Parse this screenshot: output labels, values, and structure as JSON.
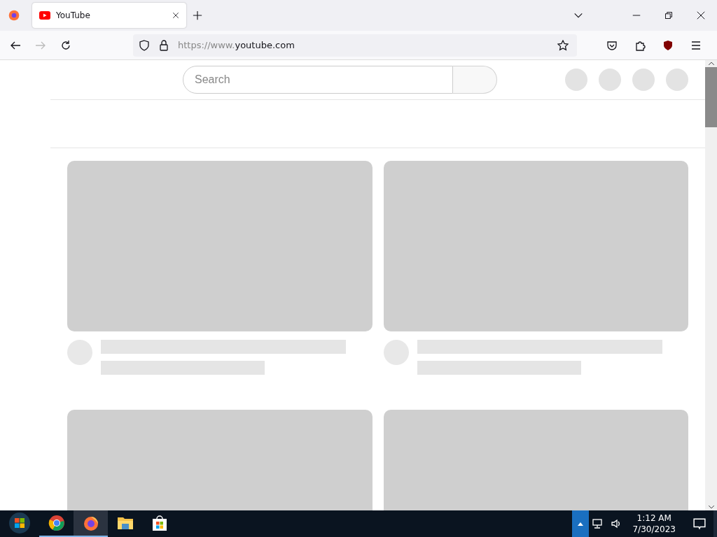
{
  "tabs": [
    {
      "title": "YouTube",
      "selected": true
    }
  ],
  "address_bar": {
    "url_prefix": "https://www.",
    "url_host": "youtube.com"
  },
  "page": {
    "search": {
      "placeholder": "Search"
    }
  },
  "taskbar": {
    "apps": [
      {
        "kind": "chrome",
        "selected": false,
        "running": true
      },
      {
        "kind": "firefox",
        "selected": true,
        "running": true
      },
      {
        "kind": "folder",
        "selected": false,
        "running": false
      },
      {
        "kind": "store",
        "selected": false,
        "running": false
      }
    ],
    "time": "1:12 AM",
    "date": "7/30/2023"
  }
}
